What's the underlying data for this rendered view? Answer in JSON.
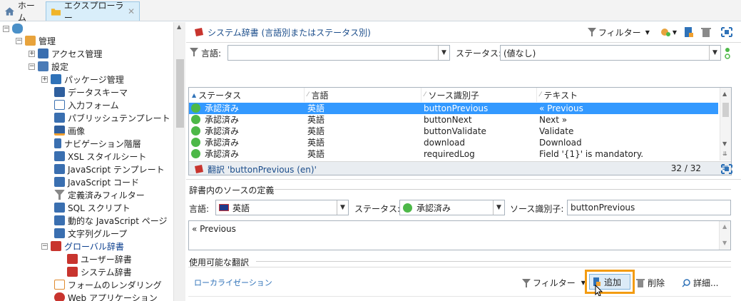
{
  "tabs": [
    {
      "label": "ホーム"
    },
    {
      "label": "エクスプローラー",
      "close": "✕"
    }
  ],
  "tree": {
    "root_label": "",
    "items": [
      {
        "label": "管理"
      },
      {
        "label": "アクセス管理"
      },
      {
        "label": "設定"
      },
      {
        "label": "パッケージ管理"
      },
      {
        "label": "データスキーマ"
      },
      {
        "label": "入力フォーム"
      },
      {
        "label": "パブリッシュテンプレート"
      },
      {
        "label": "画像"
      },
      {
        "label": "ナビゲーション階層"
      },
      {
        "label": "XSL スタイルシート"
      },
      {
        "label": "JavaScript テンプレート"
      },
      {
        "label": "JavaScript コード"
      },
      {
        "label": "定義済みフィルター"
      },
      {
        "label": "SQL スクリプト"
      },
      {
        "label": "動的な JavaScript ページ"
      },
      {
        "label": "文字列グループ"
      },
      {
        "label": "グローバル辞書"
      },
      {
        "label": "ユーザー辞書"
      },
      {
        "label": "システム辞書"
      },
      {
        "label": "フォームのレンダリング"
      },
      {
        "label": "Web アプリケーション"
      }
    ]
  },
  "top_panel": {
    "title": "システム辞書 (言語別またはステータス別)",
    "filter_label": "フィルター",
    "language_label": "言語:",
    "language_value": "",
    "status_label": "ステータス:",
    "status_value": "(値なし)",
    "columns": [
      "ステータス",
      "言語",
      "ソース識別子",
      "テキスト"
    ],
    "rows": [
      {
        "status": "承認済み",
        "lang": "英語",
        "id": "buttonPrevious",
        "text": "« Previous"
      },
      {
        "status": "承認済み",
        "lang": "英語",
        "id": "buttonNext",
        "text": "Next »"
      },
      {
        "status": "承認済み",
        "lang": "英語",
        "id": "buttonValidate",
        "text": "Validate"
      },
      {
        "status": "承認済み",
        "lang": "英語",
        "id": "download",
        "text": "Download"
      },
      {
        "status": "承認済み",
        "lang": "英語",
        "id": "requiredLog",
        "text": "Field '{1}' is mandatory."
      }
    ],
    "count": "32 / 32"
  },
  "detail_panel": {
    "title": "翻訳 'buttonPrevious (en)'",
    "source_section": "辞書内のソースの定義",
    "language_label": "言語:",
    "language_value": "英語",
    "status_label": "ステータス:",
    "status_value": "承認済み",
    "source_id_label": "ソース識別子:",
    "source_id_value": "buttonPrevious",
    "text_value": "« Previous",
    "translations_section": "使用可能な翻訳",
    "localization_label": "ローカライゼーション",
    "filter_label": "フィルター",
    "add_label": "追加",
    "delete_label": "削除",
    "detail_label": "詳細..."
  },
  "colors": {
    "accent": "#3399ff",
    "highlight": "#f39c12",
    "status_ok": "#4db848"
  }
}
